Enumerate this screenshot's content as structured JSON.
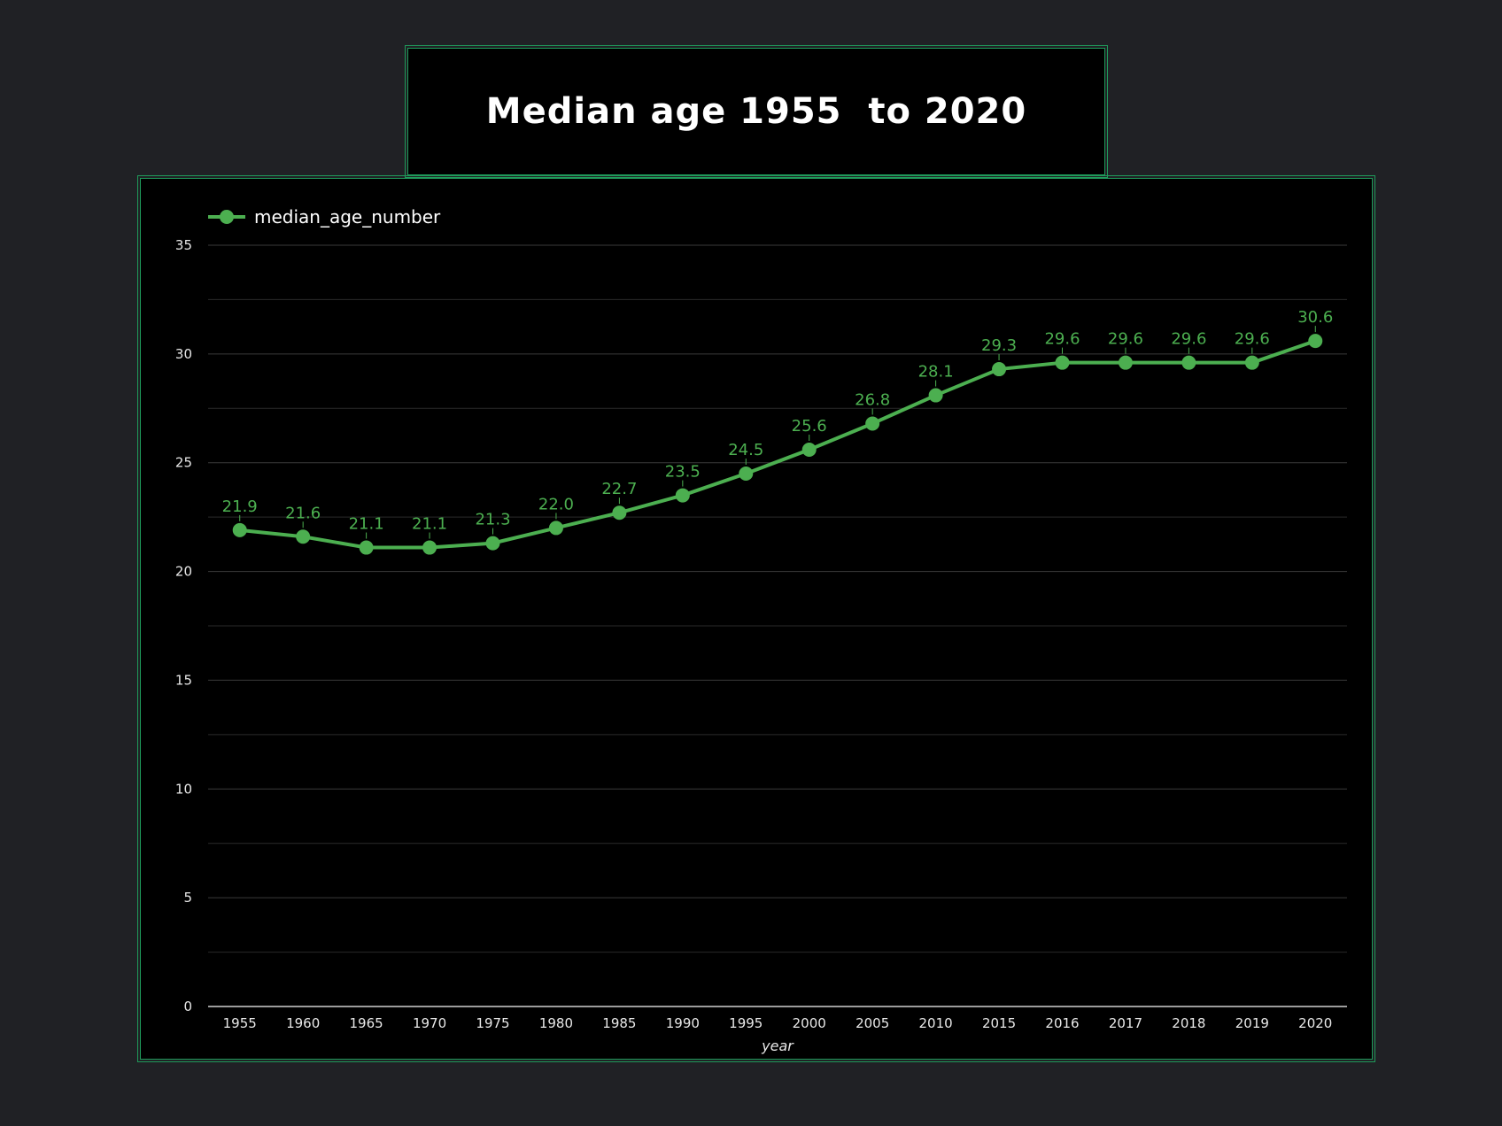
{
  "title": "Median age 1955  to 2020",
  "colors": {
    "background": "#202125",
    "panel": "#000000",
    "border": "#1f9a5a",
    "series": "#4caf50",
    "grid": "#3a3a3a",
    "text": "#e8e8e8"
  },
  "chart_data": {
    "type": "line",
    "categories": [
      "1955",
      "1960",
      "1965",
      "1970",
      "1975",
      "1980",
      "1985",
      "1990",
      "1995",
      "2000",
      "2005",
      "2010",
      "2015",
      "2016",
      "2017",
      "2018",
      "2019",
      "2020"
    ],
    "series": [
      {
        "name": "median_age_number",
        "values": [
          21.9,
          21.6,
          21.1,
          21.1,
          21.3,
          22.0,
          22.7,
          23.5,
          24.5,
          25.6,
          26.8,
          28.1,
          29.3,
          29.6,
          29.6,
          29.6,
          29.6,
          30.6
        ],
        "labels": [
          "21.9",
          "21.6",
          "21.1",
          "21.1",
          "21.3",
          "22.0",
          "22.7",
          "23.5",
          "24.5",
          "25.6",
          "26.8",
          "28.1",
          "29.3",
          "29.6",
          "29.6",
          "29.6",
          "29.6",
          "30.6"
        ]
      }
    ],
    "xlabel": "year",
    "ylabel": "",
    "ylim": [
      0,
      35
    ],
    "yticks": [
      0,
      5,
      10,
      15,
      20,
      25,
      30,
      35
    ],
    "grid": true,
    "legend_position": "top-left"
  }
}
